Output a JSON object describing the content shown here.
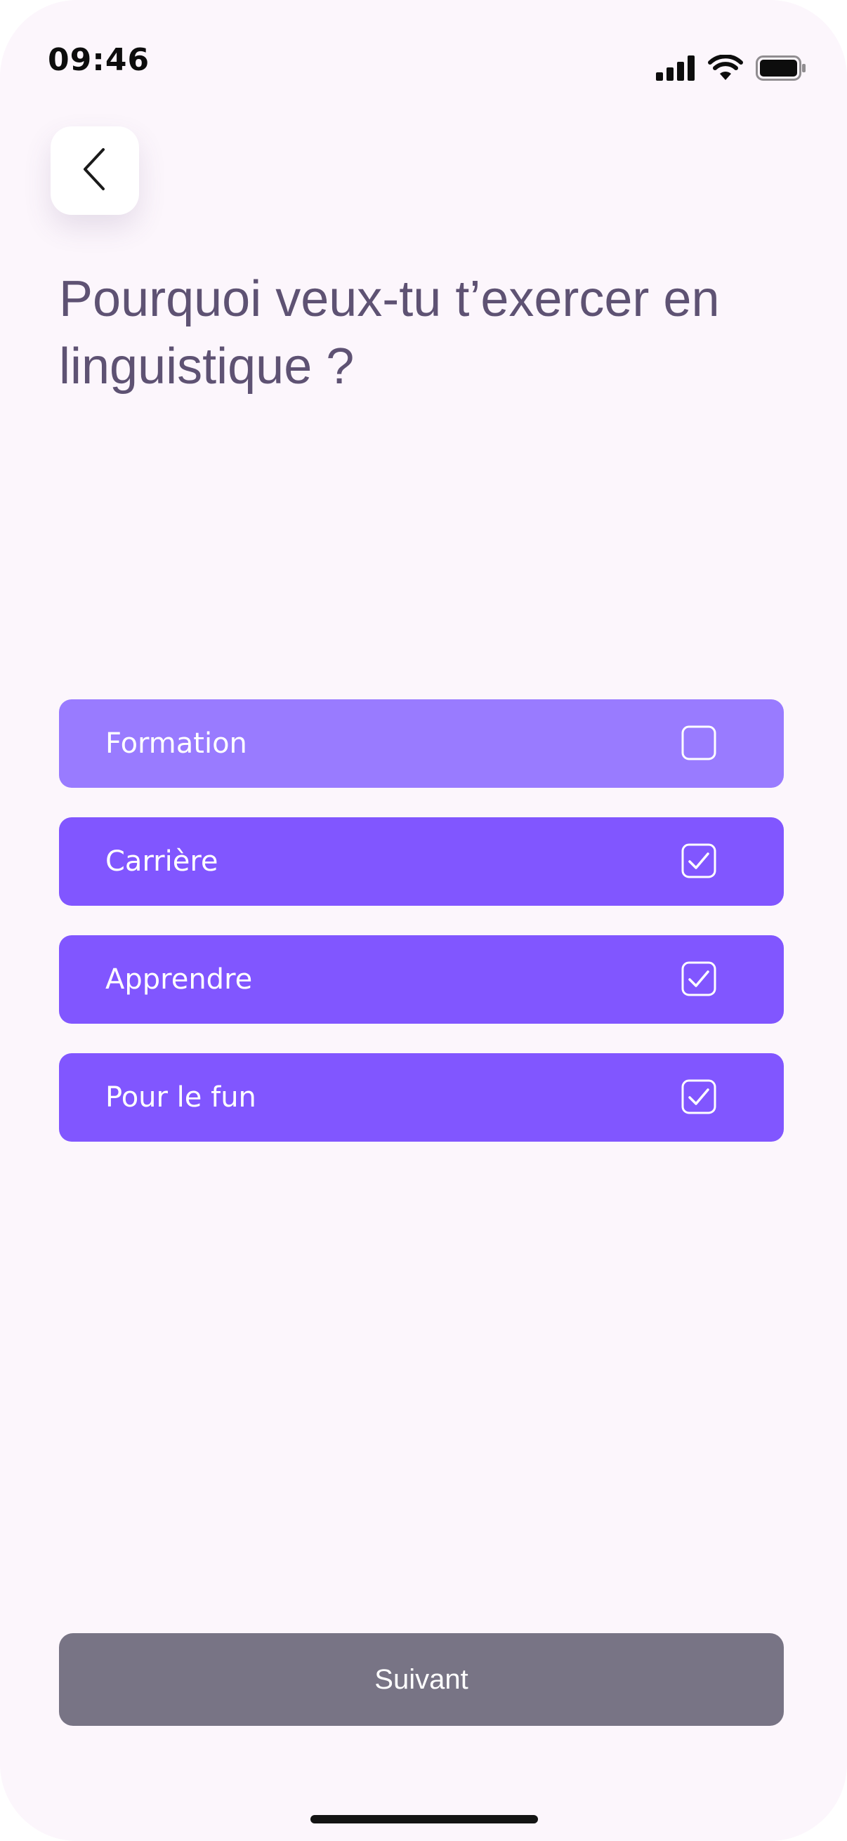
{
  "status_bar": {
    "time": "09:46",
    "icons": [
      "cellular-signal-icon",
      "wifi-icon",
      "battery-icon"
    ]
  },
  "header": {
    "back_icon": "chevron-left-icon",
    "title": "Pourquoi veux-tu t’exercer en linguistique ?"
  },
  "options": [
    {
      "label": "Formation",
      "checked": false
    },
    {
      "label": "Carrière",
      "checked": true
    },
    {
      "label": "Apprendre",
      "checked": true
    },
    {
      "label": "Pour le fun",
      "checked": true
    }
  ],
  "footer": {
    "next_label": "Suivant"
  },
  "colors": {
    "background": "#FCF6FC",
    "title": "#5E5273",
    "option_selected": "#8156FF",
    "option_unselected": "#997BFF",
    "next_button": "#787485"
  }
}
